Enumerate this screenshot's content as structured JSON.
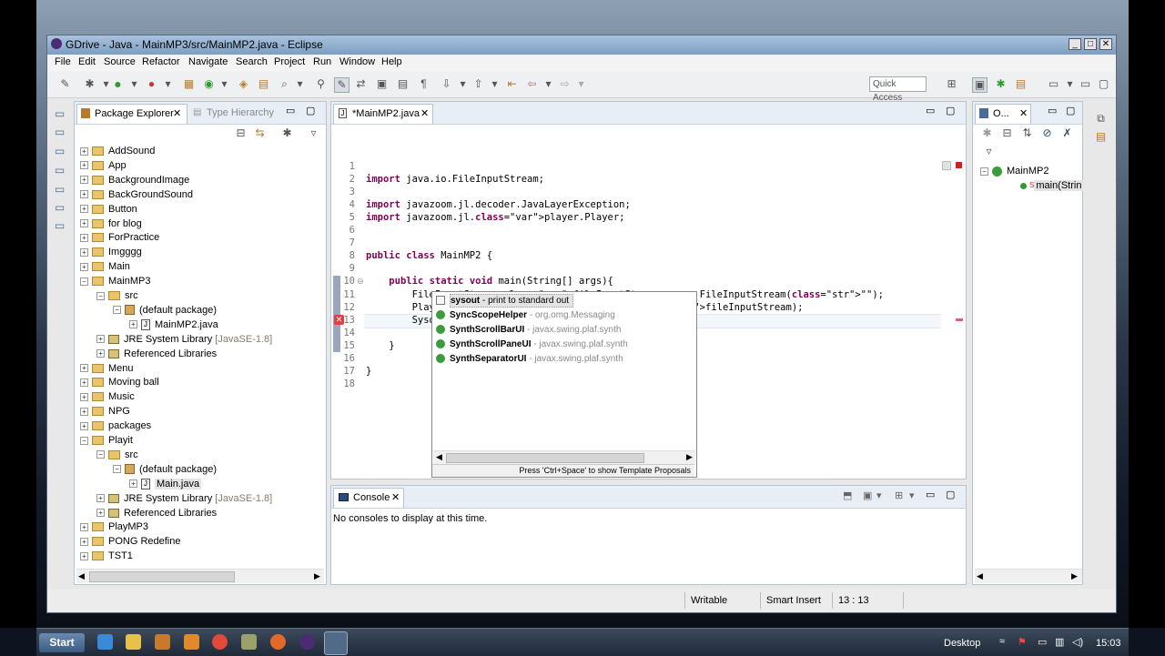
{
  "window": {
    "title": "GDrive - Java - MainMP3/src/MainMP2.java - Eclipse",
    "controls": [
      "_",
      "□",
      "✕"
    ]
  },
  "menu": [
    "File",
    "Edit",
    "Source",
    "Refactor",
    "Navigate",
    "Search",
    "Project",
    "Run",
    "Window",
    "Help"
  ],
  "toolbar": {
    "quick_access": "Quick Access"
  },
  "package_explorer": {
    "tab_label": "Package Explorer",
    "other_tab_label": "Type Hierarchy",
    "tree": [
      {
        "label": "AddSound",
        "level": 0,
        "kind": "project",
        "exp": "+"
      },
      {
        "label": "App",
        "level": 0,
        "kind": "project",
        "exp": "+"
      },
      {
        "label": "BackgroundImage",
        "level": 0,
        "kind": "project",
        "exp": "+"
      },
      {
        "label": "BackGroundSound",
        "level": 0,
        "kind": "project",
        "exp": "+"
      },
      {
        "label": "Button",
        "level": 0,
        "kind": "project",
        "exp": "+"
      },
      {
        "label": "for blog",
        "level": 0,
        "kind": "project",
        "exp": "+"
      },
      {
        "label": "ForPractice",
        "level": 0,
        "kind": "project",
        "exp": "+"
      },
      {
        "label": "Imgggg",
        "level": 0,
        "kind": "project",
        "exp": "+"
      },
      {
        "label": "Main",
        "level": 0,
        "kind": "project",
        "exp": "+"
      },
      {
        "label": "MainMP3",
        "level": 0,
        "kind": "project",
        "exp": "-"
      },
      {
        "label": "src",
        "level": 1,
        "kind": "srcfolder",
        "exp": "-"
      },
      {
        "label": "(default package)",
        "level": 2,
        "kind": "package",
        "exp": "-"
      },
      {
        "label": "MainMP2.java",
        "level": 3,
        "kind": "java",
        "exp": "+"
      },
      {
        "label": "JRE System Library",
        "suffix": " [JavaSE-1.8]",
        "level": 1,
        "kind": "lib",
        "exp": "+"
      },
      {
        "label": "Referenced Libraries",
        "level": 1,
        "kind": "lib",
        "exp": "+"
      },
      {
        "label": "Menu",
        "level": 0,
        "kind": "project",
        "exp": "+"
      },
      {
        "label": "Moving ball",
        "level": 0,
        "kind": "project",
        "exp": "+"
      },
      {
        "label": "Music",
        "level": 0,
        "kind": "project",
        "exp": "+"
      },
      {
        "label": "NPG",
        "level": 0,
        "kind": "project",
        "exp": "+"
      },
      {
        "label": "packages",
        "level": 0,
        "kind": "project",
        "exp": "+"
      },
      {
        "label": "Playit",
        "level": 0,
        "kind": "project",
        "exp": "-"
      },
      {
        "label": "src",
        "level": 1,
        "kind": "srcfolder",
        "exp": "-"
      },
      {
        "label": "(default package)",
        "level": 2,
        "kind": "package",
        "exp": "-"
      },
      {
        "label": "Main.java",
        "level": 3,
        "kind": "java",
        "exp": "+",
        "selected": true
      },
      {
        "label": "JRE System Library",
        "suffix": " [JavaSE-1.8]",
        "level": 1,
        "kind": "lib",
        "exp": "+"
      },
      {
        "label": "Referenced Libraries",
        "level": 1,
        "kind": "lib",
        "exp": "+"
      },
      {
        "label": "PlayMP3",
        "level": 0,
        "kind": "project",
        "exp": "+"
      },
      {
        "label": "PONG Redefine",
        "level": 0,
        "kind": "project",
        "exp": "+"
      },
      {
        "label": "TST1",
        "level": 0,
        "kind": "project",
        "exp": "+"
      }
    ]
  },
  "editor": {
    "tab_label": "*MainMP2.java",
    "lines": [
      {
        "n": "1",
        "code": ""
      },
      {
        "n": "2",
        "code": "import java.io.FileInputStream;"
      },
      {
        "n": "3",
        "code": ""
      },
      {
        "n": "4",
        "code": "import javazoom.jl.decoder.JavaLayerException;"
      },
      {
        "n": "5",
        "code": "import javazoom.jl.player.Player;"
      },
      {
        "n": "6",
        "code": ""
      },
      {
        "n": "7",
        "code": ""
      },
      {
        "n": "8",
        "code": "public class MainMP2 {"
      },
      {
        "n": "9",
        "code": ""
      },
      {
        "n": "10",
        "code": "    public static void main(String[] args){"
      },
      {
        "n": "11",
        "code": "        FileInputStream fileInputStream = new FileInputStream(\"\");"
      },
      {
        "n": "12",
        "code": "        Player player = new Player(fileInputStream);"
      },
      {
        "n": "13",
        "code": "        Syso"
      },
      {
        "n": "14",
        "code": ""
      },
      {
        "n": "15",
        "code": "    }"
      },
      {
        "n": "16",
        "code": ""
      },
      {
        "n": "17",
        "code": "}"
      },
      {
        "n": "18",
        "code": ""
      }
    ]
  },
  "autocomplete": {
    "items": [
      {
        "name": "sysout",
        "detail": " - print to standard out",
        "icon": "template",
        "selected": true
      },
      {
        "name": "SyncScopeHelper",
        "detail": " - org.omg.Messaging",
        "icon": "class"
      },
      {
        "name": "SynthScrollBarUI",
        "detail": " - javax.swing.plaf.synth",
        "icon": "class"
      },
      {
        "name": "SynthScrollPaneUI",
        "detail": " - javax.swing.plaf.synth",
        "icon": "class"
      },
      {
        "name": "SynthSeparatorUI",
        "detail": " - javax.swing.plaf.synth",
        "icon": "class"
      }
    ],
    "hint": "Press 'Ctrl+Space' to show Template Proposals"
  },
  "console": {
    "tab_label": "Console",
    "message": "No consoles to display at this time."
  },
  "outline": {
    "tab_label": "O...",
    "class_name": "MainMP2",
    "method_name": "main(Strin",
    "method_modifier": "S"
  },
  "status": {
    "writable": "Writable",
    "insert_mode": "Smart Insert",
    "position": "13 : 13"
  },
  "taskbar": {
    "start_label": "Start",
    "desktop_label": "Desktop",
    "clock": "15:03"
  }
}
